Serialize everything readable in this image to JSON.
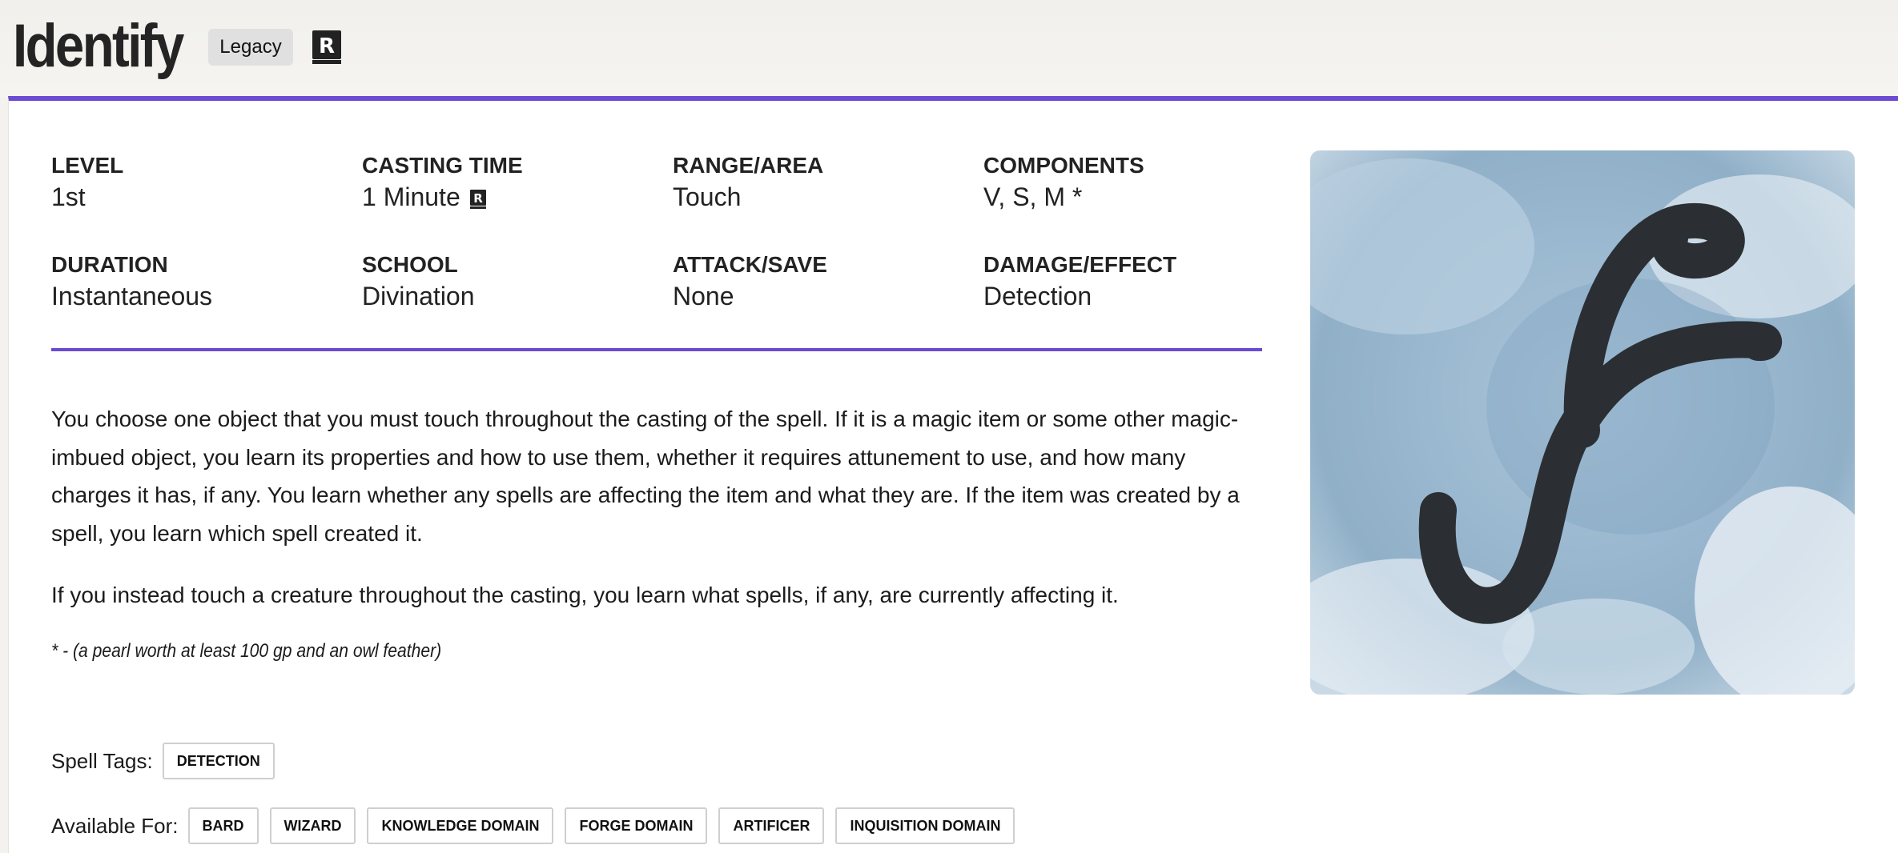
{
  "header": {
    "title": "Identify",
    "badge": "Legacy",
    "source_icon": "r-book-icon"
  },
  "stats": [
    {
      "label": "LEVEL",
      "value": "1st"
    },
    {
      "label": "CASTING TIME",
      "value": "1 Minute"
    },
    {
      "label": "RANGE/AREA",
      "value": "Touch"
    },
    {
      "label": "COMPONENTS",
      "value": "V, S, M *"
    },
    {
      "label": "DURATION",
      "value": "Instantaneous"
    },
    {
      "label": "SCHOOL",
      "value": "Divination"
    },
    {
      "label": "ATTACK/SAVE",
      "value": "None"
    },
    {
      "label": "DAMAGE/EFFECT",
      "value": "Detection"
    }
  ],
  "description": {
    "p1": "You choose one object that you must touch throughout the casting of the spell. If it is a magic item or some other magic-imbued object, you learn its properties and how to use them, whether it requires attunement to use, and how many charges it has, if any. You learn whether any spells are affecting the item and what they are. If the item was created by a spell, you learn which spell created it.",
    "p2": "If you instead touch a creature throughout the casting, you learn what spells, if any, are currently affecting it.",
    "footnote": "* - (a pearl worth at least 100 gp and an owl feather)"
  },
  "spell_tags": {
    "label": "Spell Tags:",
    "tags": [
      "DETECTION"
    ]
  },
  "available_for": {
    "label": "Available For:",
    "classes": [
      "BARD",
      "WIZARD",
      "KNOWLEDGE DOMAIN",
      "FORGE DOMAIN",
      "ARTIFICER",
      "INQUISITION DOMAIN"
    ]
  },
  "colors": {
    "accent": "#6a4bd1",
    "art_background": "#9cbad2",
    "glyph": "#2b2f33"
  }
}
